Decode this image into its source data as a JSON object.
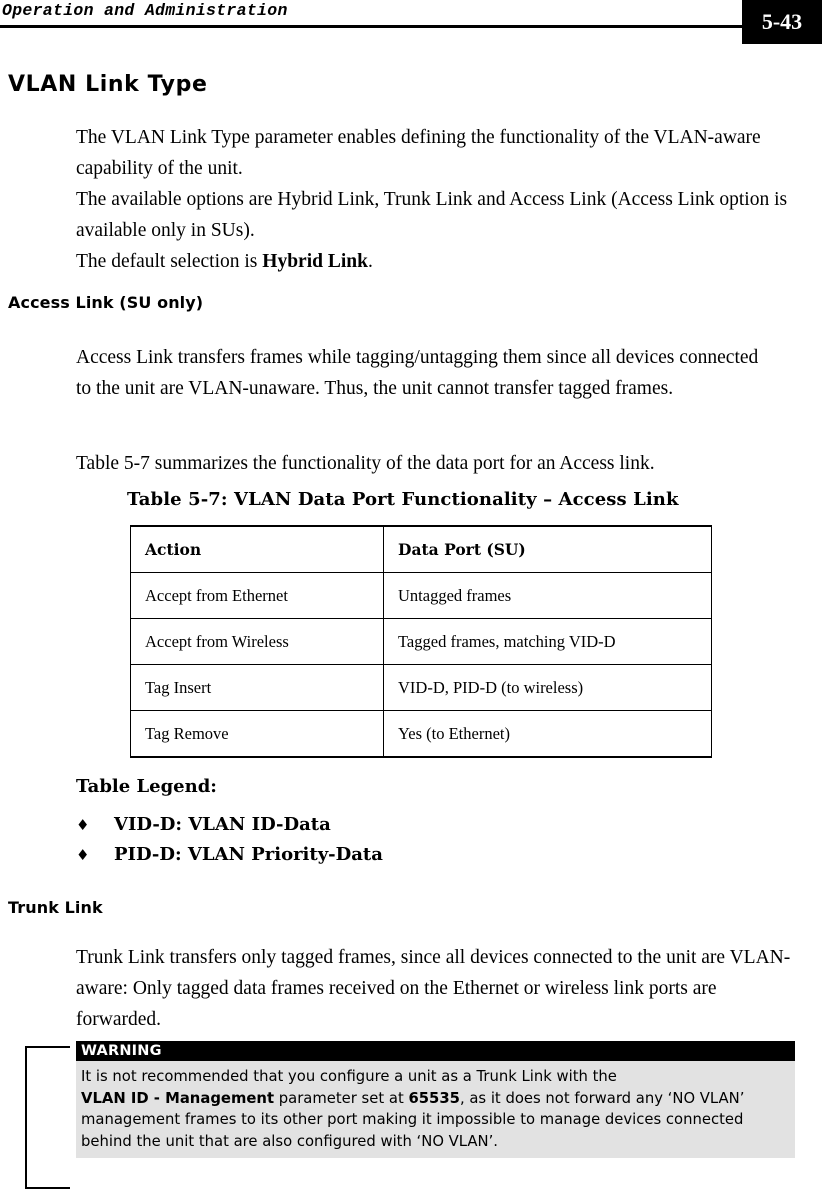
{
  "header": {
    "running_title": "Operation and Administration",
    "page_number": "5-43"
  },
  "section": {
    "title": "VLAN Link Type",
    "intro_line_1": "The VLAN Link Type parameter enables defining the functionality of the VLAN-aware capability of the unit.",
    "intro_line_2": "The available options are Hybrid Link, Trunk Link and Access Link (Access Link option is available only in SUs).",
    "intro_line_3_prefix": "The default selection is ",
    "intro_line_3_bold": "Hybrid Link",
    "intro_line_3_suffix": "."
  },
  "access_link": {
    "heading": "Access Link (SU only)",
    "paragraph": "Access Link transfers frames while tagging/untagging them since all devices connected to the unit are VLAN-unaware. Thus, the unit cannot transfer tagged frames.",
    "table_reference": "Table 5-7 summarizes the functionality of the data port for an Access link."
  },
  "table": {
    "caption": "Table 5-7: VLAN Data Port Functionality – Access Link",
    "columns": [
      "Action",
      "Data Port (SU)"
    ],
    "rows": [
      [
        "Accept from Ethernet",
        "Untagged frames"
      ],
      [
        "Accept from Wireless",
        "Tagged frames, matching VID-D"
      ],
      [
        "Tag Insert",
        "VID-D, PID-D (to wireless)"
      ],
      [
        "Tag Remove",
        "Yes (to Ethernet)"
      ]
    ]
  },
  "legend": {
    "title": "Table Legend:",
    "bullet_glyph": "♦",
    "items": [
      {
        "term": "VID-D",
        "separator": ": ",
        "definition": "VLAN ID-Data"
      },
      {
        "term": "PID-D",
        "separator": ": ",
        "definition": "VLAN Priority-Data"
      }
    ]
  },
  "trunk_link": {
    "heading": "Trunk Link",
    "paragraph": "Trunk Link transfers only tagged frames, since all devices connected to the unit are VLAN-aware: Only tagged data frames received on the Ethernet or wireless link ports are forwarded."
  },
  "warning": {
    "label": "WARNING",
    "line_1": "It is not recommended that you configure a unit as a Trunk Link with the",
    "line_2_bold_1": "VLAN ID - Management",
    "line_2_mid": " parameter set at ",
    "line_2_bold_2": "65535",
    "line_2_tail": ", as it does not forward any ‘NO VLAN’",
    "line_3": "management frames to its other port making it impossible to manage devices connected",
    "line_4": "behind the unit that are also configured with ‘NO VLAN’."
  },
  "colors": {
    "page_background": "#ffffff",
    "text": "#000000",
    "page_number_background": "#000000",
    "page_number_text": "#ffffff",
    "warning_header_background": "#000000",
    "warning_body_background": "#e2e2e2"
  }
}
